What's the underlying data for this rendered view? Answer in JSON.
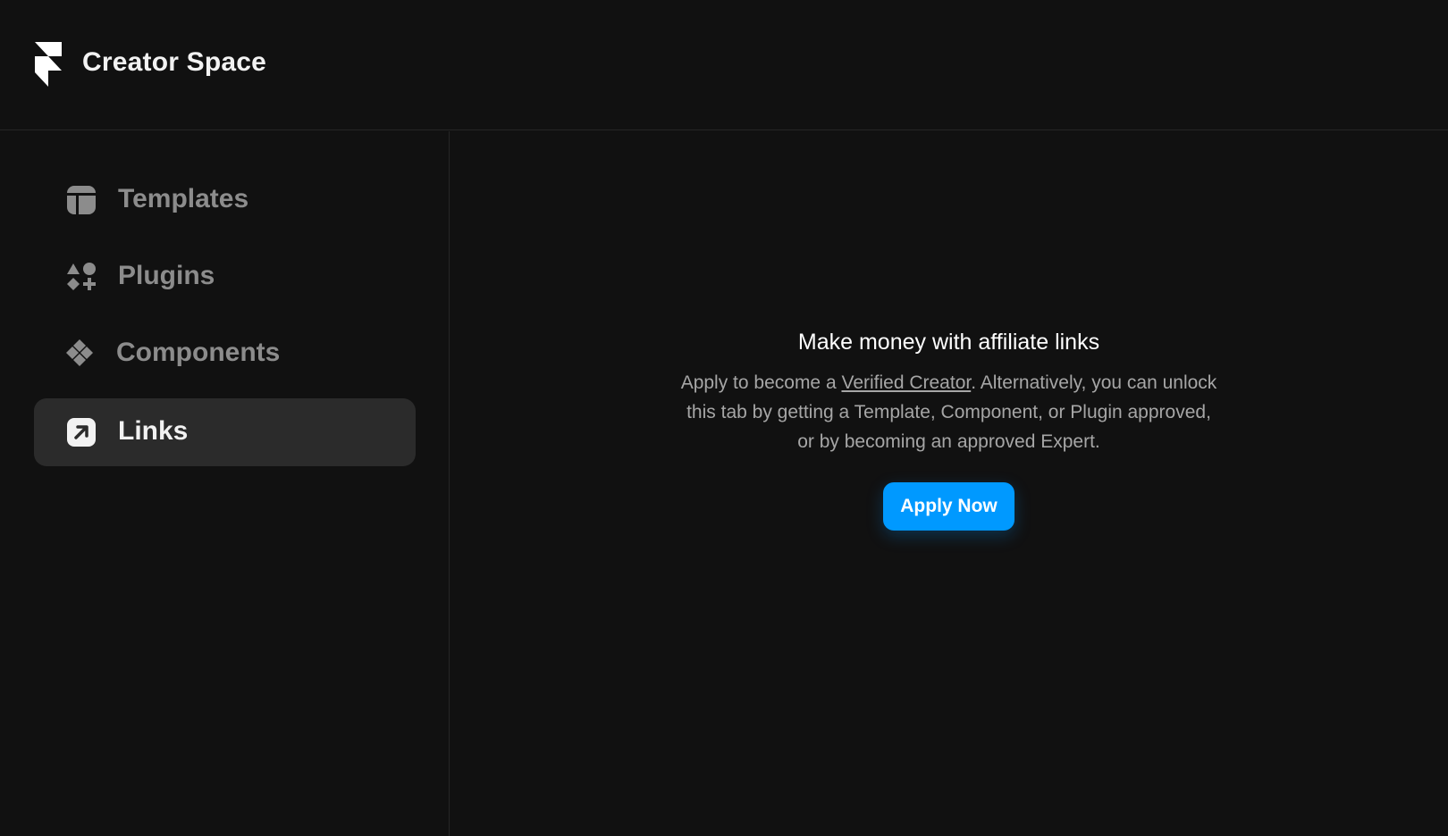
{
  "app": {
    "title": "Creator Space",
    "logo_icon": "framer-logo-icon"
  },
  "sidebar": {
    "items": [
      {
        "label": "Templates",
        "icon": "templates-icon",
        "active": false
      },
      {
        "label": "Plugins",
        "icon": "plugins-icon",
        "active": false
      },
      {
        "label": "Components",
        "icon": "components-icon",
        "active": false
      },
      {
        "label": "Links",
        "icon": "links-icon",
        "active": true
      }
    ]
  },
  "main": {
    "title": "Make money with affiliate links",
    "desc_before": "Apply to become a ",
    "desc_link": "Verified Creator",
    "desc_after": ". Alternatively, you can unlock this tab by getting a Template, Component, or Plugin approved, or by becoming an approved Expert.",
    "button_label": "Apply Now"
  },
  "colors": {
    "background": "#111111",
    "active_item": "#2b2b2b",
    "accent": "#0099ff",
    "muted_text": "#8c8c8c"
  }
}
